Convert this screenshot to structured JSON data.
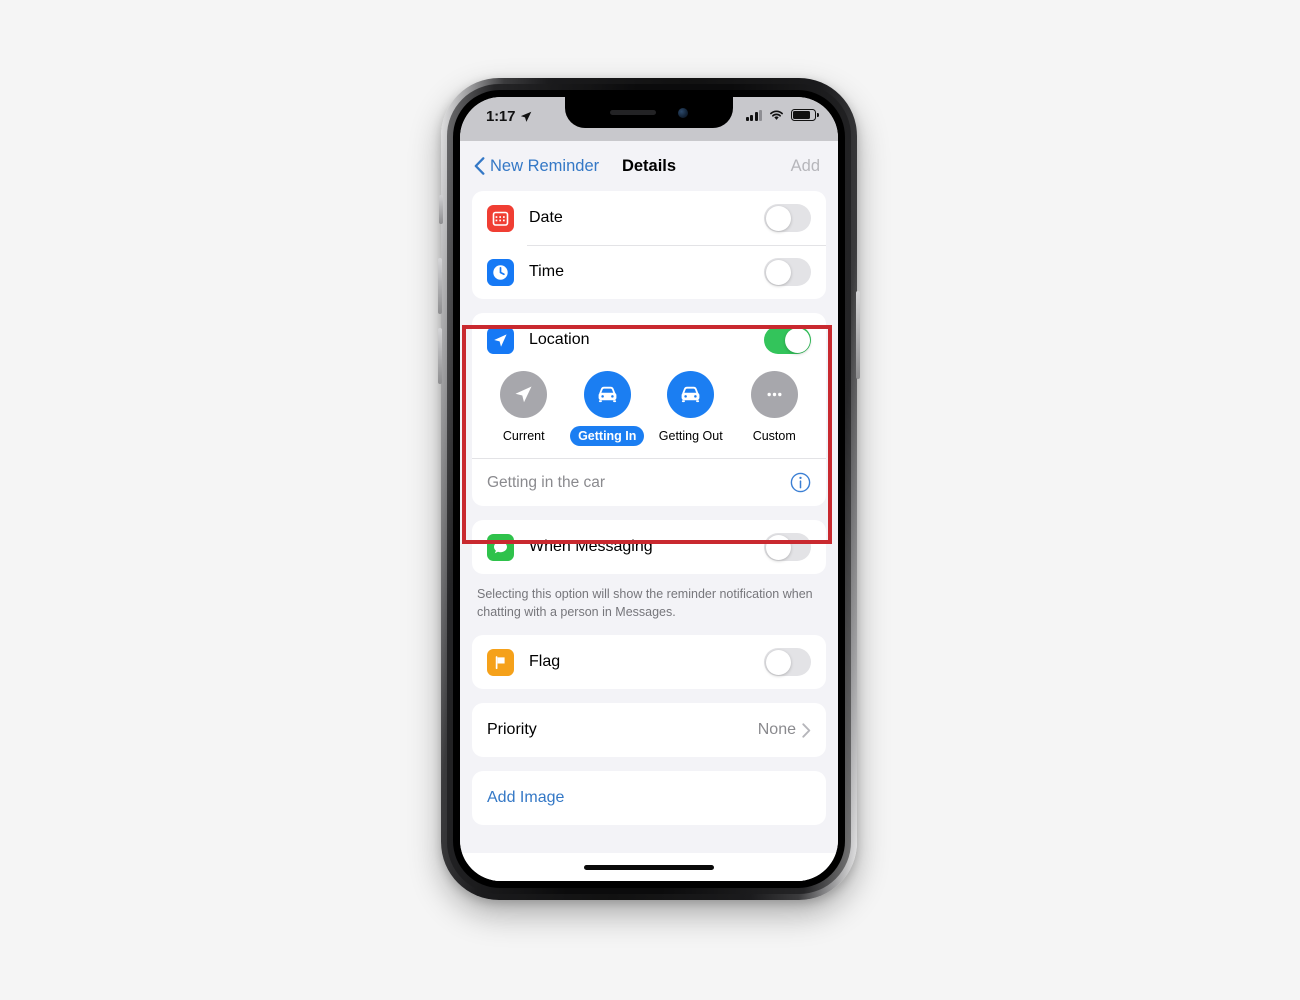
{
  "status_bar": {
    "time": "1:17",
    "location_arrow_icon": "location-arrow-icon",
    "signal_icon": "cellular-signal-icon",
    "wifi_icon": "wifi-icon",
    "battery_icon": "battery-icon"
  },
  "nav_bar": {
    "back_label": "New Reminder",
    "title": "Details",
    "add_label": "Add"
  },
  "colors": {
    "accent_blue": "#1b7ef2",
    "link_blue": "#3478c6",
    "toggle_on_green": "#33c45b",
    "date_icon_red": "#f03e33",
    "time_icon_blue": "#1679f5",
    "messaging_icon_green": "#2fc24b",
    "flag_icon_orange": "#f5a11a",
    "annotation_red": "#c9292f",
    "inactive_gray": "#a7a7ac"
  },
  "sections": {
    "datetime": {
      "rows": [
        {
          "label": "Date",
          "icon": "calendar-icon",
          "toggle": "off"
        },
        {
          "label": "Time",
          "icon": "clock-icon",
          "toggle": "off"
        }
      ]
    },
    "location": {
      "label": "Location",
      "icon": "location-arrow-icon",
      "toggle": "on",
      "options": [
        {
          "label": "Current",
          "icon": "location-arrow-icon",
          "state": "unselected",
          "circle": "gray"
        },
        {
          "label": "Getting In",
          "icon": "car-icon",
          "state": "selected",
          "circle": "blue"
        },
        {
          "label": "Getting Out",
          "icon": "car-icon",
          "state": "unselected",
          "circle": "blue"
        },
        {
          "label": "Custom",
          "icon": "ellipsis-icon",
          "state": "unselected",
          "circle": "gray"
        }
      ],
      "detail_text": "Getting in the car",
      "info_icon": "info-circle-icon"
    },
    "messaging": {
      "label": "When Messaging",
      "icon": "message-bubble-icon",
      "toggle": "off",
      "footnote": "Selecting this option will show the reminder notification when chatting with a person in Messages."
    },
    "flag": {
      "label": "Flag",
      "icon": "flag-icon",
      "toggle": "off"
    },
    "priority": {
      "label": "Priority",
      "value": "None",
      "chevron_icon": "chevron-right-icon"
    },
    "add_image": {
      "label": "Add Image"
    }
  }
}
